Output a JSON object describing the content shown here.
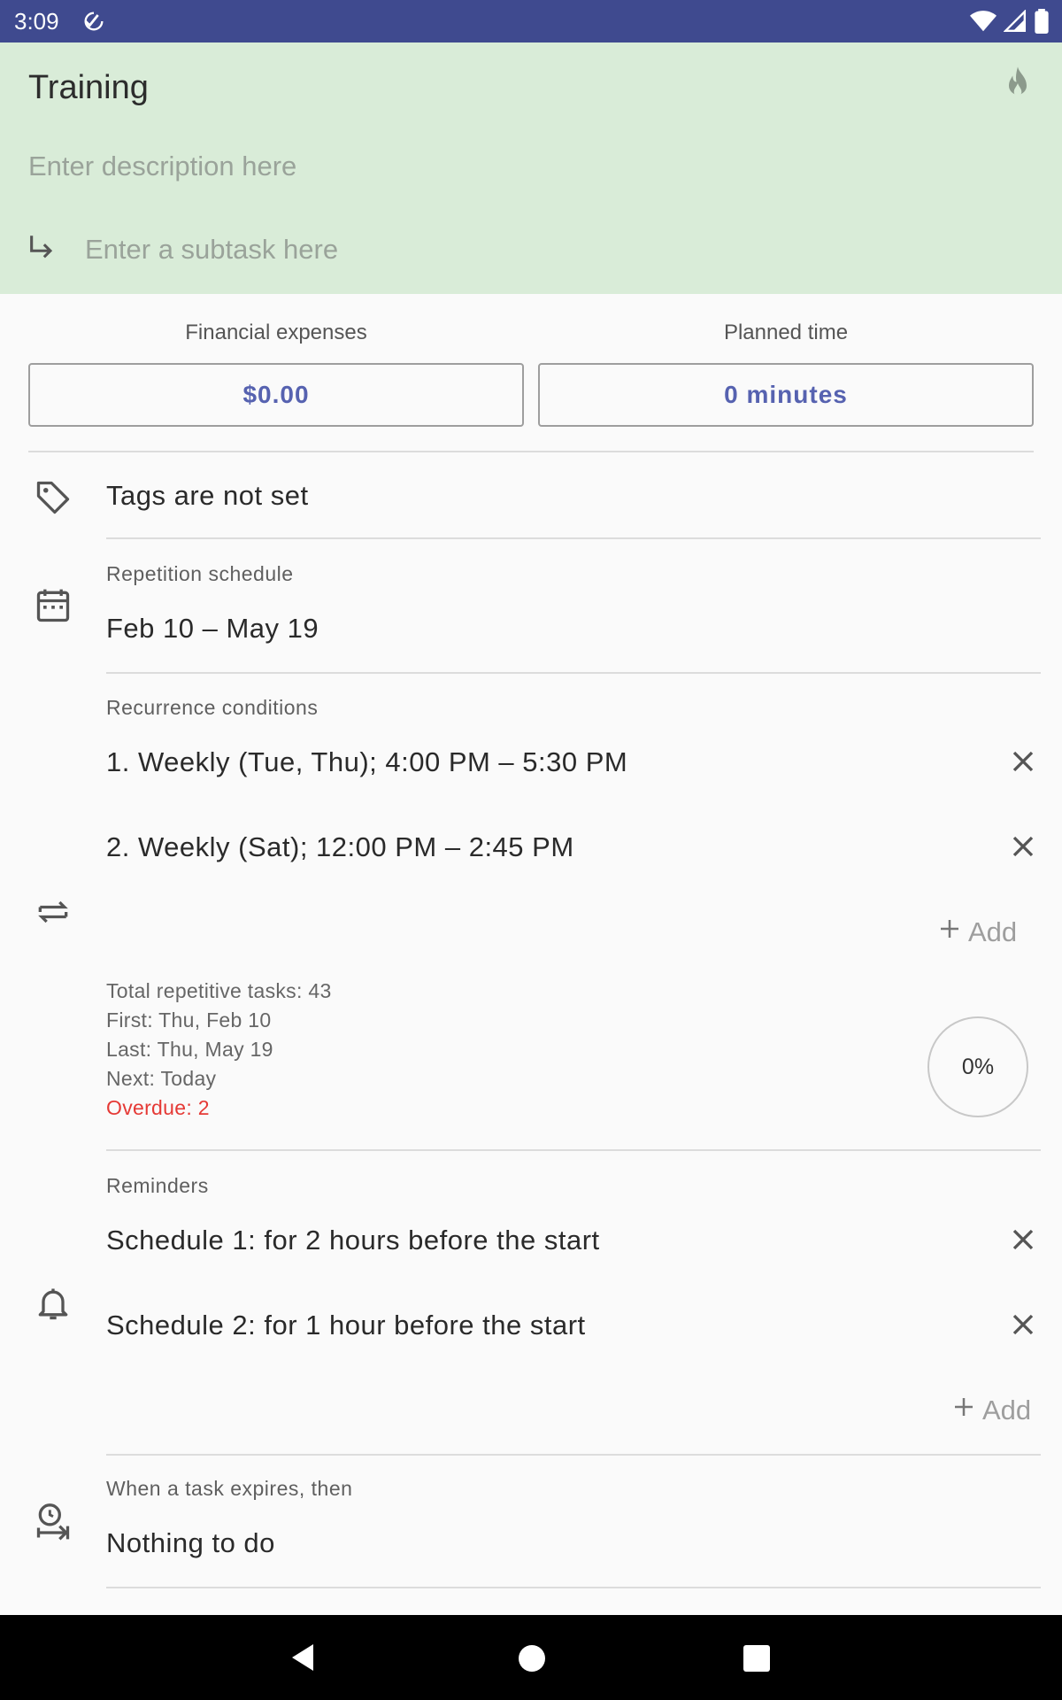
{
  "status_bar": {
    "time": "3:09"
  },
  "header": {
    "title": "Training",
    "description_placeholder": "Enter description here",
    "subtask_placeholder": "Enter a subtask here"
  },
  "finance": {
    "expenses_label": "Financial expenses",
    "expenses_value": "$0.00",
    "time_label": "Planned time",
    "time_value": "0 minutes"
  },
  "tags": {
    "text": "Tags are not set"
  },
  "schedule": {
    "label": "Repetition schedule",
    "value": "Feb 10 – May 19"
  },
  "recurrence": {
    "label": "Recurrence conditions",
    "items": [
      "1. Weekly (Tue, Thu); 4:00 PM – 5:30 PM",
      "2. Weekly (Sat); 12:00 PM – 2:45 PM"
    ],
    "add_label": "Add",
    "stats": {
      "total": "Total repetitive tasks: 43",
      "first": "First: Thu, Feb 10",
      "last": "Last: Thu, May 19",
      "next": "Next: Today",
      "overdue": "Overdue: 2"
    },
    "progress_text": "0%",
    "progress_value": 0
  },
  "reminders": {
    "label": "Reminders",
    "items": [
      "Schedule 1: for 2 hours before the start",
      "Schedule 2: for 1 hour before the start"
    ],
    "add_label": "Add"
  },
  "expiry": {
    "label": "When a task expires, then",
    "value": "Nothing to do"
  },
  "colors": {
    "status_bar": "#3f4a8f",
    "header_bg": "#d9ecd8",
    "accent": "#5662b0",
    "overdue": "#e53935"
  }
}
